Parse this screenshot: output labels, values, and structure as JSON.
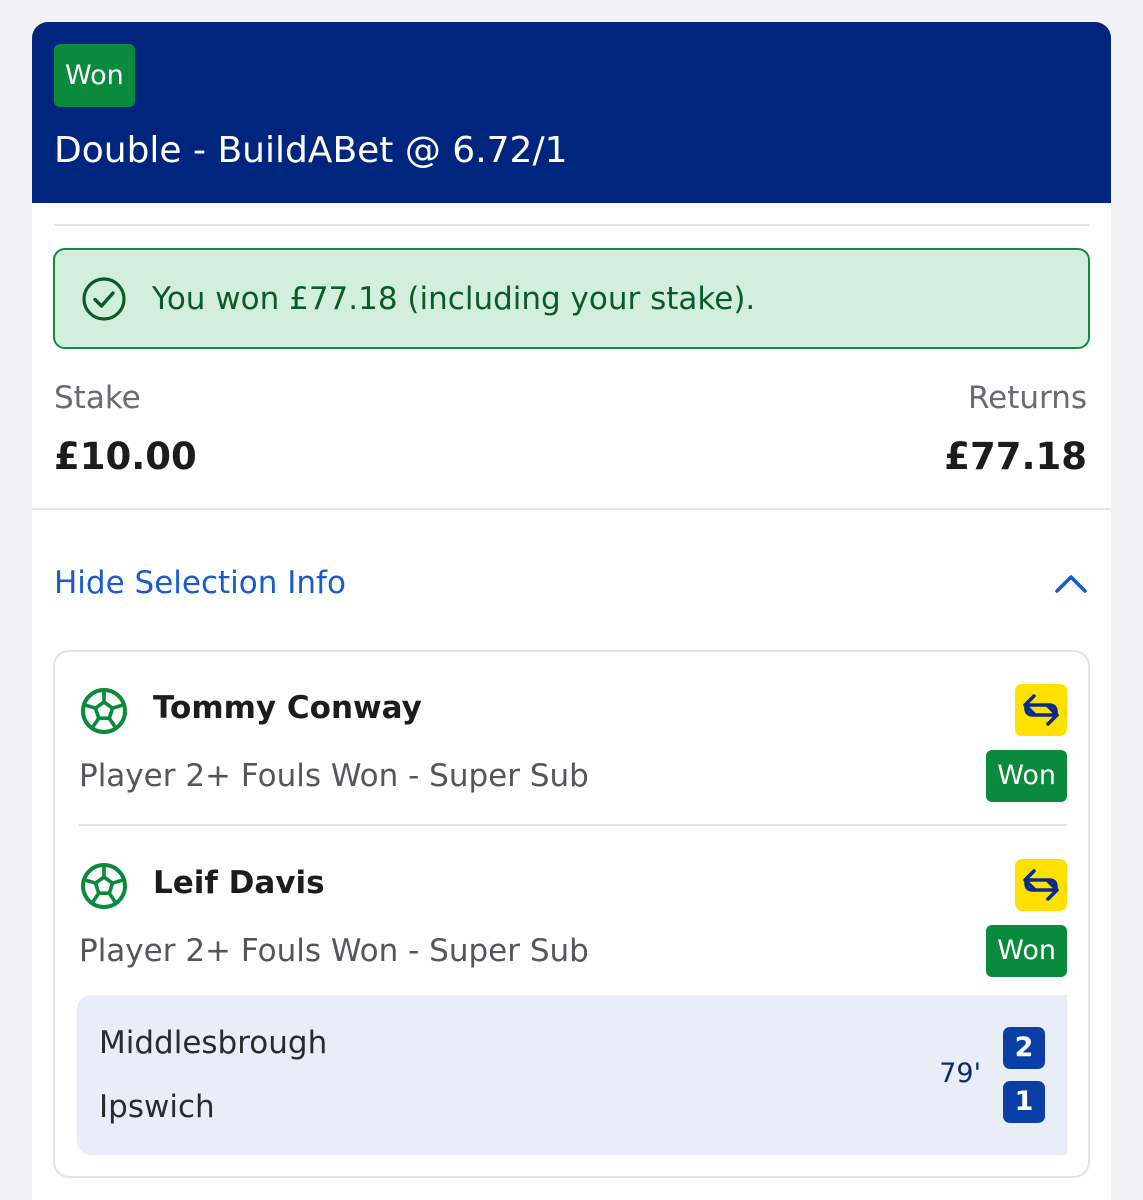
{
  "header": {
    "status_badge": "Won",
    "bet_title": "Double - BuildABet @ 6.72/1"
  },
  "win_banner": {
    "icon": "check-circle-icon",
    "text": "You won £77.18 (including your stake)."
  },
  "summary": {
    "stake_label": "Stake",
    "stake_value": "£10.00",
    "returns_label": "Returns",
    "returns_value": "£77.18"
  },
  "selection_toggle": {
    "label": "Hide Selection Info",
    "icon": "chevron-up-icon"
  },
  "selections": [
    {
      "player": "Tommy Conway",
      "market": "Player 2+ Fouls Won - Super Sub",
      "status": "Won",
      "sport_icon": "football-icon",
      "feature_icon": "super-sub-swap-icon"
    },
    {
      "player": "Leif Davis",
      "market": "Player 2+ Fouls Won - Super Sub",
      "status": "Won",
      "sport_icon": "football-icon",
      "feature_icon": "super-sub-swap-icon"
    }
  ],
  "match": {
    "home_team": "Middlesbrough",
    "away_team": "Ipswich",
    "minute": "79'",
    "home_score": "2",
    "away_score": "1"
  },
  "colors": {
    "header_bg": "#00257e",
    "won_green": "#0a8a3c",
    "banner_bg": "#d2eedd",
    "link_blue": "#1a5cd0",
    "super_sub_yellow": "#ffe100",
    "score_blue": "#0a3fa8"
  }
}
